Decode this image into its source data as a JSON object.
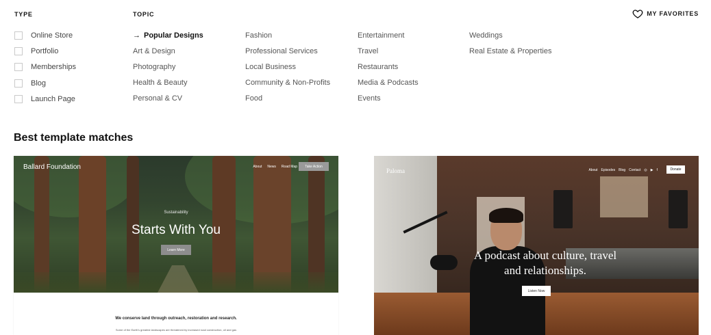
{
  "filters": {
    "type_heading": "TYPE",
    "topic_heading": "TOPIC",
    "type_items": [
      "Online Store",
      "Portfolio",
      "Memberships",
      "Blog",
      "Launch Page"
    ],
    "topic_columns": [
      [
        "Popular Designs",
        "Art & Design",
        "Photography",
        "Health & Beauty",
        "Personal & CV"
      ],
      [
        "Fashion",
        "Professional Services",
        "Local Business",
        "Community & Non-Profits",
        "Food"
      ],
      [
        "Entertainment",
        "Travel",
        "Restaurants",
        "Media & Podcasts",
        "Events"
      ],
      [
        "Weddings",
        "Real Estate & Properties"
      ]
    ],
    "active_topic_arrow": "→",
    "favorites_label": "MY FAVORITES"
  },
  "section_title": "Best template matches",
  "templates": {
    "forest": {
      "brand": "Ballard Foundation",
      "nav": [
        "About",
        "News",
        "Road Map"
      ],
      "cta": "Take Action",
      "eyebrow": "Sustainability",
      "headline": "Starts With You",
      "button": "Learn More",
      "mission": "We conserve land through outreach, restoration and research.",
      "description": "Some of the Earth's greatest landscapes are threatened by increased road construction, oil and gas"
    },
    "podcast": {
      "brand": "Paloma",
      "nav": [
        "About",
        "Episodes",
        "Blog",
        "Contact"
      ],
      "cta": "Donate",
      "headline_line1": "A podcast about culture, travel",
      "headline_line2": "and relationships.",
      "button": "Listen Now"
    }
  },
  "colors": {
    "checkbox_border": "#c9c9c9",
    "text_muted": "#555555",
    "text_strong": "#111111"
  }
}
